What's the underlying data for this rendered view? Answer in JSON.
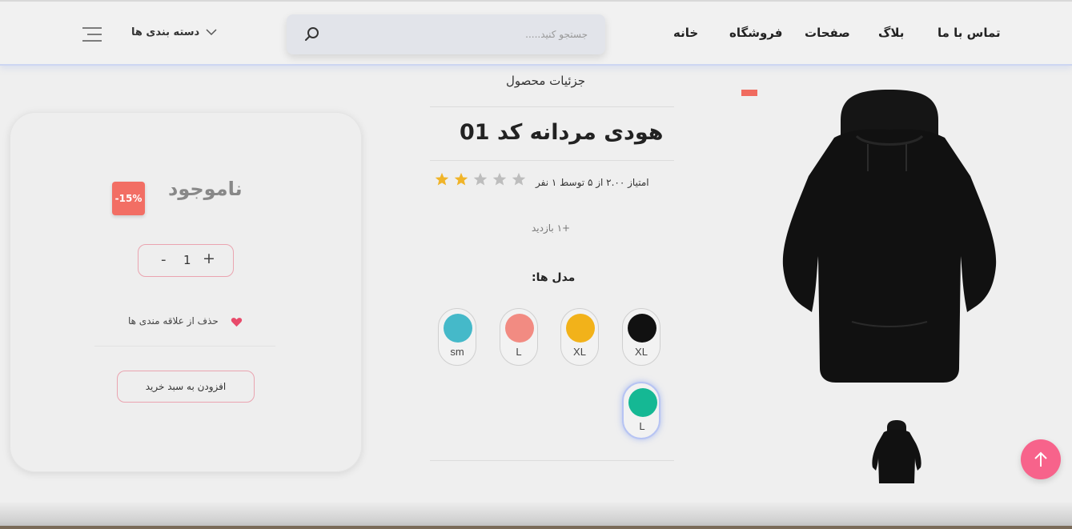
{
  "header": {
    "nav": {
      "contact": "تماس با ما",
      "blog": "بلاگ",
      "pages": "صفحات",
      "shop": "فروشگاه",
      "home": "خانه"
    },
    "search": {
      "placeholder": "جستجو کنید....."
    },
    "categories_label": "دسته بندی ها",
    "icons": [
      "search-icon",
      "chevron-down-icon",
      "menu-icon"
    ]
  },
  "details": {
    "section_title": "جزئیات محصول",
    "product_title": "هودی مردانه کد 01",
    "rating_text": "امتیاز ۲.۰۰ از ۵ توسط ۱ نفر",
    "rating": {
      "value": 2,
      "max": 5
    },
    "views": "+۱ بازدید",
    "models_label": "مدل ها:",
    "models": [
      {
        "label": "XL",
        "color": "#111111"
      },
      {
        "label": "XL",
        "color": "#f2b21a"
      },
      {
        "label": "L",
        "color": "#f28b82"
      },
      {
        "label": "sm",
        "color": "#45b9c9"
      },
      {
        "label": "L",
        "color": "#15b894",
        "selected": true
      }
    ]
  },
  "purchase": {
    "stock_status": "ناموجود",
    "discount": "-15%",
    "quantity": "1",
    "minus": "-",
    "plus": "+",
    "favorite_text": "حذف از علاقه مندی ها",
    "add_to_cart": "افزودن به سبد خرید"
  },
  "colors": {
    "accent_pink": "#f7638b",
    "discount_red": "#f26e64",
    "star_gold": "#f0b429",
    "star_gray": "#bdbdbd"
  }
}
